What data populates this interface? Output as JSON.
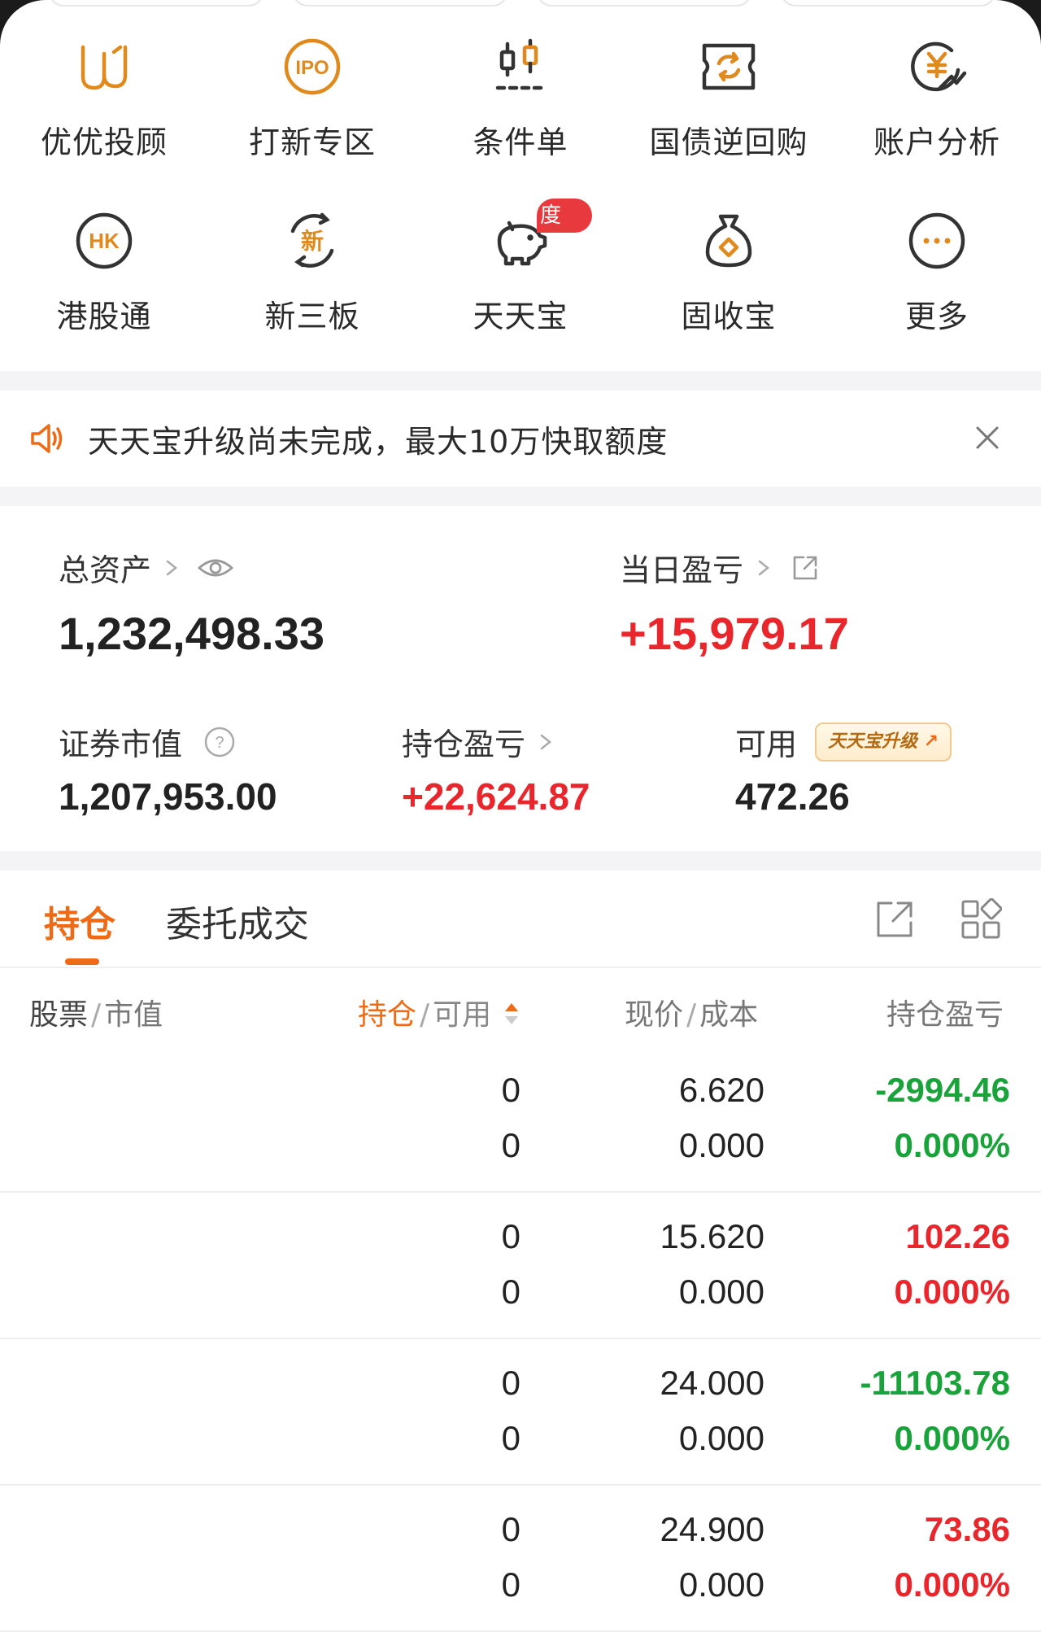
{
  "menu": {
    "items": [
      {
        "label": "优优投顾",
        "icon": "uu-advisor-icon"
      },
      {
        "label": "打新专区",
        "icon": "ipo-icon"
      },
      {
        "label": "条件单",
        "icon": "candlestick-icon"
      },
      {
        "label": "国债逆回购",
        "icon": "repo-ticket-icon"
      },
      {
        "label": "账户分析",
        "icon": "yen-chart-icon"
      },
      {
        "label": "港股通",
        "icon": "hk-icon"
      },
      {
        "label": "新三板",
        "icon": "new-board-icon"
      },
      {
        "label": "天天宝",
        "icon": "piggy-bank-icon",
        "badge": "度"
      },
      {
        "label": "固收宝",
        "icon": "money-bag-icon"
      },
      {
        "label": "更多",
        "icon": "more-icon"
      }
    ]
  },
  "notice": {
    "text": "天天宝升级尚未完成，最大10万快取额度"
  },
  "assets": {
    "total_label": "总资产",
    "total_value": "1,232,498.33",
    "daily_pl_label": "当日盈亏",
    "daily_pl_value": "+15,979.17",
    "market_value_label": "证券市值",
    "market_value": "1,207,953.00",
    "position_pl_label": "持仓盈亏",
    "position_pl_value": "+22,624.87",
    "available_label": "可用",
    "available_value": "472.26",
    "upgrade_tag": "天天宝升级"
  },
  "tabs": {
    "positions": "持仓",
    "orders": "委托成交"
  },
  "table": {
    "headers": {
      "stock": "股票",
      "stock_sub": "市值",
      "hold": "持仓",
      "hold_sub": "可用",
      "price": "现价",
      "price_sub": "成本",
      "pl": "持仓盈亏"
    },
    "rows": [
      {
        "hold": "0",
        "available": "0",
        "price": "6.620",
        "cost": "0.000",
        "pl": "-2994.46",
        "pl_pct": "0.000%",
        "trend": "down"
      },
      {
        "hold": "0",
        "available": "0",
        "price": "15.620",
        "cost": "0.000",
        "pl": "102.26",
        "pl_pct": "0.000%",
        "trend": "up"
      },
      {
        "hold": "0",
        "available": "0",
        "price": "24.000",
        "cost": "0.000",
        "pl": "-11103.78",
        "pl_pct": "0.000%",
        "trend": "down"
      },
      {
        "hold": "0",
        "available": "0",
        "price": "24.900",
        "cost": "0.000",
        "pl": "73.86",
        "pl_pct": "0.000%",
        "trend": "up"
      }
    ]
  },
  "colors": {
    "accent": "#ee6a15",
    "gain": "#e8262c",
    "loss": "#1aa33a",
    "icon": "#e08a1e"
  }
}
